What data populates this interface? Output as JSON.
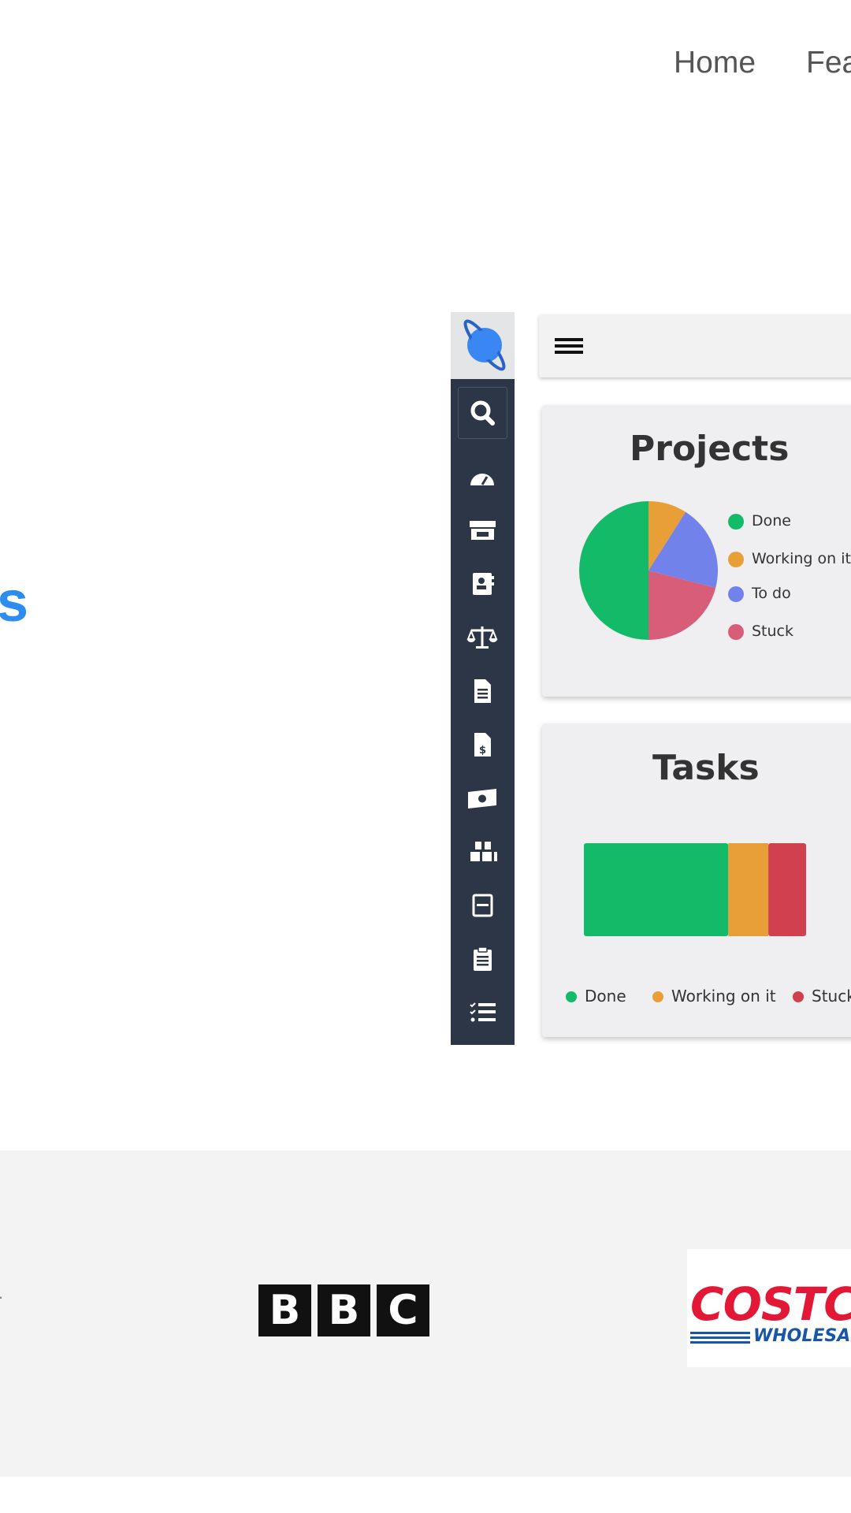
{
  "nav": {
    "links": [
      "Home",
      "Features"
    ]
  },
  "hero": {
    "headline_fragment": "s",
    "accent_color": "#2d8cf0"
  },
  "mockup": {
    "sidebar": {
      "icons": [
        "planet-logo-icon",
        "search-icon",
        "dashboard-icon",
        "store-icon",
        "contacts-icon",
        "balance-scale-icon",
        "document-icon",
        "invoice-icon",
        "money-icon",
        "inventory-icon",
        "form-icon",
        "clipboard-icon",
        "checklist-icon"
      ]
    },
    "topbar": {
      "menu_icon": "hamburger-icon"
    },
    "projects": {
      "title": "Projects",
      "chart_data": {
        "type": "pie",
        "title": "Projects",
        "labels": [
          "Done",
          "Working on it",
          "To do",
          "Stuck"
        ],
        "values": [
          50,
          9,
          20,
          21
        ],
        "colors": [
          "#13bb68",
          "#e99f37",
          "#7182ea",
          "#d75d78"
        ],
        "legend": "right"
      }
    },
    "tasks": {
      "title": "Tasks",
      "chart_data": {
        "type": "bar",
        "title": "Tasks",
        "orientation": "horizontal-stacked",
        "series": [
          {
            "name": "Done",
            "values": [
              65
            ]
          },
          {
            "name": "Working on it",
            "values": [
              18
            ]
          },
          {
            "name": "Stuck",
            "values": [
              17
            ]
          }
        ],
        "colors": [
          "#13bb68",
          "#e99f37",
          "#d0404e"
        ],
        "legend": "bottom"
      }
    }
  },
  "logos": {
    "bbc": [
      "B",
      "B",
      "C"
    ],
    "costco_word": "COSTCO",
    "costco_sub": "WHOLESALE",
    "edge_mark": "."
  }
}
